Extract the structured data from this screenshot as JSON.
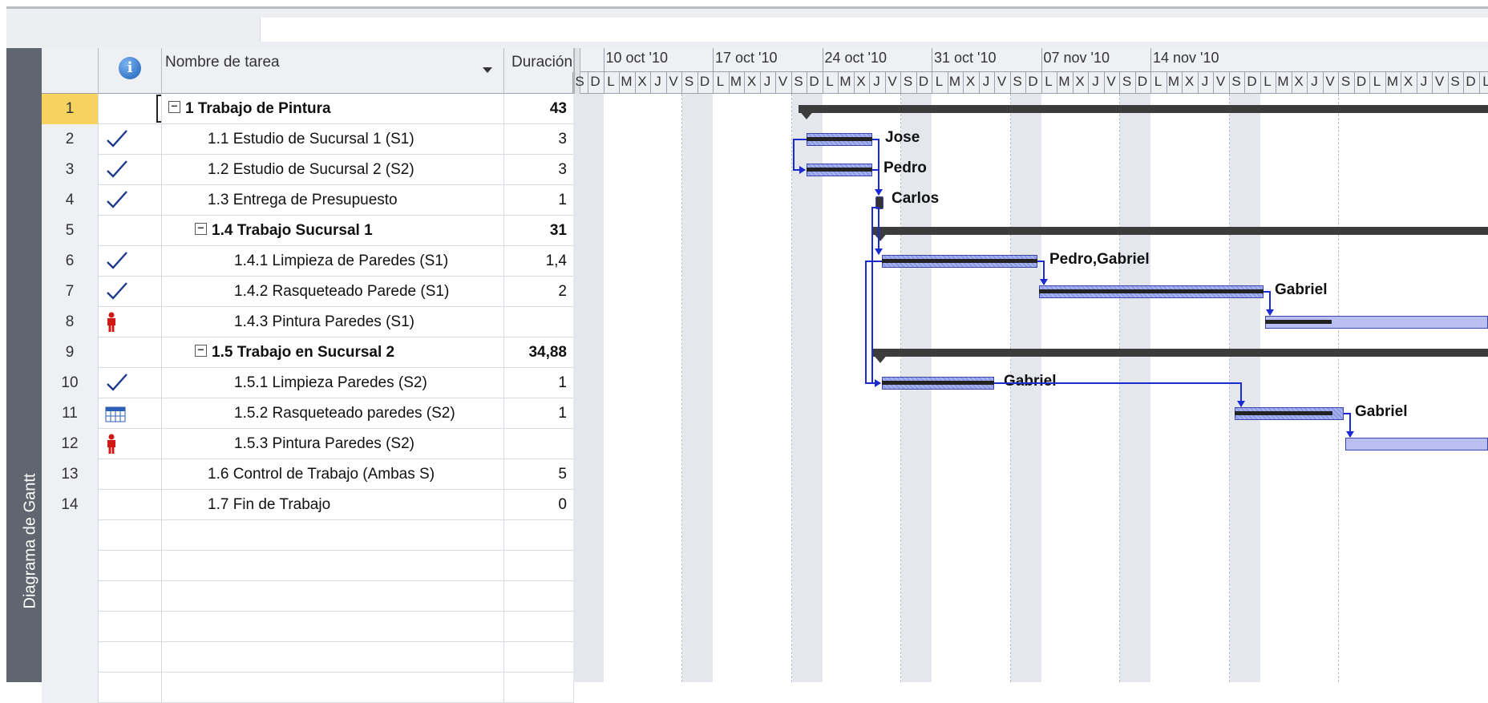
{
  "view": {
    "sidebar_label": "Diagrama de Gantt"
  },
  "columns": {
    "info_icon": "i",
    "task_name": "Nombre de tarea",
    "duration": "Duración"
  },
  "rows": [
    {
      "id": "1",
      "indicator": "",
      "name": "1 Trabajo de Pintura",
      "duration": "43",
      "summary": true
    },
    {
      "id": "2",
      "indicator": "check-icon",
      "name": "1.1 Estudio de Sucursal 1 (S1)",
      "duration": "3",
      "summary": false
    },
    {
      "id": "3",
      "indicator": "check-icon",
      "name": "1.2 Estudio de Sucursal 2 (S2)",
      "duration": "3",
      "summary": false
    },
    {
      "id": "4",
      "indicator": "check-icon",
      "name": "1.3 Entrega de Presupuesto",
      "duration": "1",
      "summary": false
    },
    {
      "id": "5",
      "indicator": "",
      "name": "1.4 Trabajo Sucursal 1",
      "duration": "31",
      "summary": true
    },
    {
      "id": "6",
      "indicator": "check-icon",
      "name": "1.4.1 Limpieza de Paredes (S1)",
      "duration": "1,4",
      "summary": false
    },
    {
      "id": "7",
      "indicator": "check-icon",
      "name": "1.4.2 Rasqueteado Parede (S1)",
      "duration": "2",
      "summary": false
    },
    {
      "id": "8",
      "indicator": "person-icon",
      "name": "1.4.3 Pintura Paredes (S1)",
      "duration": "",
      "summary": false
    },
    {
      "id": "9",
      "indicator": "",
      "name": "1.5 Trabajo en Sucursal 2",
      "duration": "34,88",
      "summary": true
    },
    {
      "id": "10",
      "indicator": "check-icon",
      "name": "1.5.1 Limpieza Paredes (S2)",
      "duration": "1",
      "summary": false
    },
    {
      "id": "11",
      "indicator": "calendar-icon",
      "name": "1.5.2 Rasqueteado paredes (S2)",
      "duration": "1",
      "summary": false
    },
    {
      "id": "12",
      "indicator": "person-icon",
      "name": "1.5.3 Pintura Paredes (S2)",
      "duration": "",
      "summary": false
    },
    {
      "id": "13",
      "indicator": "",
      "name": "1.6 Control de Trabajo (Ambas S)",
      "duration": "5",
      "summary": false
    },
    {
      "id": "14",
      "indicator": "",
      "name": "1.7 Fin de Trabajo",
      "duration": "0",
      "summary": false
    }
  ],
  "timescale": {
    "weeks": [
      "10 oct '10",
      "17 oct '10",
      "24 oct '10",
      "31 oct '10",
      "07 nov '10",
      "14 nov '10"
    ],
    "days": [
      "S",
      "D",
      "L",
      "M",
      "X",
      "J",
      "V"
    ]
  },
  "bars": {
    "resources": [
      "Jose",
      "Pedro",
      "Carlos",
      "Pedro,Gabriel",
      "Gabriel",
      "Gabriel",
      "Gabriel"
    ]
  },
  "colors": {
    "selected_row": "#f6d25f",
    "task_bar": "#8a98e6",
    "link": "#1c2bd0",
    "summary": "#3c3c3c"
  }
}
